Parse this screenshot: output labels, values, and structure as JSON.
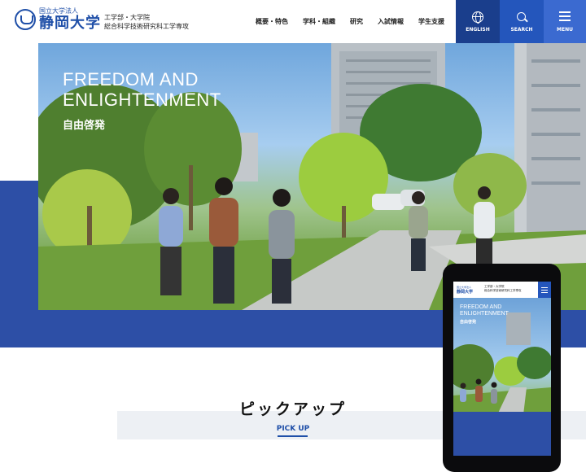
{
  "header": {
    "logo_small": "国立大学法人",
    "logo_big": "静岡大学",
    "dept_line1": "工学部・大学院",
    "dept_line2": "総合科学技術研究科工学専攻",
    "nav": [
      "概要・特色",
      "学科・組織",
      "研究",
      "入試情報",
      "学生支援"
    ],
    "english_label": "ENGLISH",
    "search_label": "SEARCH",
    "menu_label": "MENU",
    "colors": {
      "dark_blue": "#1a3e8c",
      "blue": "#2456bc",
      "light_blue": "#3b6ad0"
    }
  },
  "hero": {
    "title_line1": "FREEDOM AND",
    "title_line2": "ENLIGHTENMENT",
    "subtitle": "自由啓発"
  },
  "pickup": {
    "title_ja": "ピックアップ",
    "title_en": "PICK UP"
  },
  "mobile": {
    "logo_small": "国立大学法人",
    "logo_big": "静岡大学",
    "dept_line1": "工学部・大学院",
    "dept_line2": "総合科学技術研究科工学専攻",
    "title_line1": "FREEDOM AND",
    "title_line2": "ENLIGHTENMENT",
    "subtitle": "自由啓発"
  },
  "icons": [
    "university-seal-icon",
    "globe-icon",
    "search-icon",
    "hamburger-menu-icon"
  ],
  "accent_color": "#2d4fa6"
}
